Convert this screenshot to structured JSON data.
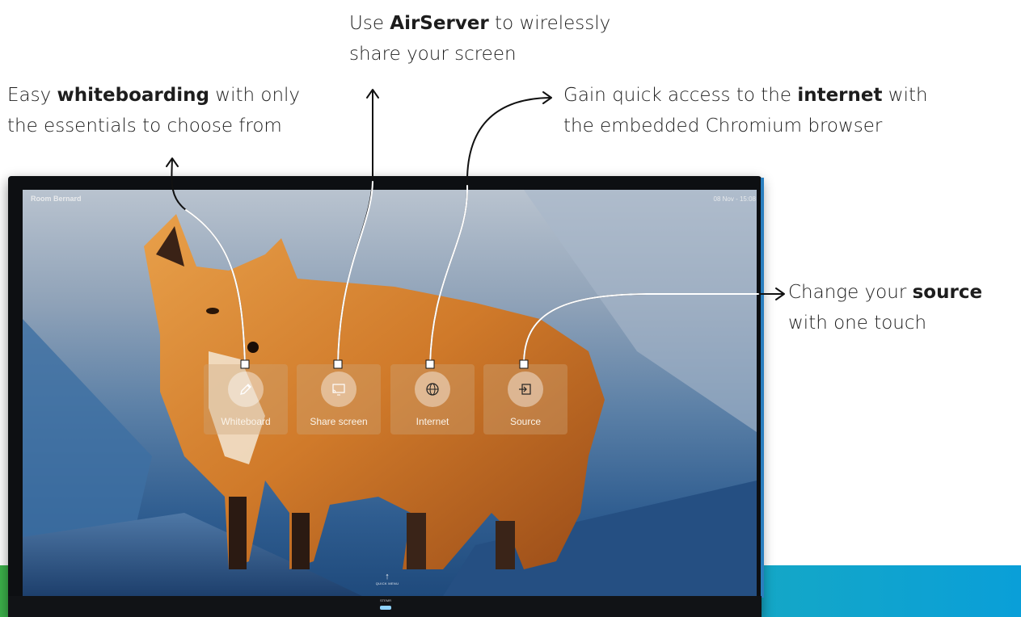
{
  "display": {
    "room_name": "Room Bernard",
    "datetime": "08 Nov - 15:08",
    "quick_menu_label": "QUICK MENU",
    "brand": "STEMR"
  },
  "tiles": [
    {
      "label": "Whiteboard",
      "icon": "pencil-icon"
    },
    {
      "label": "Share screen",
      "icon": "cast-screen-icon"
    },
    {
      "label": "Internet",
      "icon": "globe-icon"
    },
    {
      "label": "Source",
      "icon": "input-source-icon"
    }
  ],
  "callouts": {
    "airserver": {
      "pre": "Use ",
      "bold": "AirServer",
      "post": " to wirelessly",
      "line2": "share your screen"
    },
    "whiteboarding": {
      "pre": "Easy ",
      "bold": "whiteboarding",
      "post": " with only",
      "line2": "the essentials to choose from"
    },
    "internet": {
      "pre": "Gain quick access to the ",
      "bold": "internet",
      "post": " with",
      "line2": "the embedded Chromium browser"
    },
    "source": {
      "pre": "Change your ",
      "bold": "source",
      "post": "",
      "line2": "with one touch"
    }
  },
  "colors": {
    "band_green": "#3cb14a",
    "band_blue": "#0a9fd8",
    "text": "#1d1d1d"
  }
}
